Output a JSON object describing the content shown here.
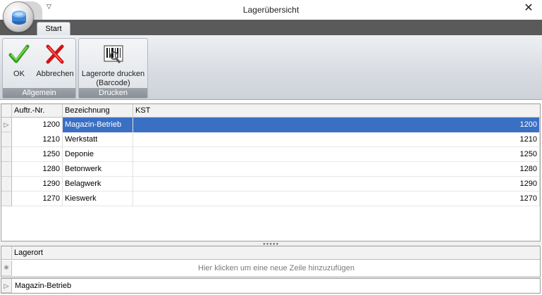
{
  "window": {
    "title": "Lagerübersicht"
  },
  "tabs": [
    {
      "label": "Start"
    }
  ],
  "ribbon": {
    "groups": [
      {
        "label": "Allgemein",
        "buttons": [
          {
            "label": "OK"
          },
          {
            "label": "Abbrechen"
          }
        ]
      },
      {
        "label": "Drucken",
        "buttons": [
          {
            "label": "Lagerorte drucken\n(Barcode)"
          }
        ]
      }
    ]
  },
  "grid": {
    "columns": [
      "Auftr.-Nr.",
      "Bezeichnung",
      "KST"
    ],
    "rows": [
      {
        "nr": "1200",
        "bezeichnung": "Magazin-Betrieb",
        "kst": "1200"
      },
      {
        "nr": "1210",
        "bezeichnung": "Werkstatt",
        "kst": "1210"
      },
      {
        "nr": "1250",
        "bezeichnung": "Deponie",
        "kst": "1250"
      },
      {
        "nr": "1280",
        "bezeichnung": "Betonwerk",
        "kst": "1280"
      },
      {
        "nr": "1290",
        "bezeichnung": "Belagwerk",
        "kst": "1290"
      },
      {
        "nr": "1270",
        "bezeichnung": "Kieswerk",
        "kst": "1270"
      }
    ],
    "selected_row_index": 0
  },
  "detail_grid": {
    "column": "Lagerort",
    "new_row_hint": "Hier klicken um eine neue Zeile hinzuzufügen",
    "group_value": "Magazin-Betrieb"
  },
  "colors": {
    "selection": "#3a70c4",
    "tabstrip": "#5a5a5a"
  }
}
